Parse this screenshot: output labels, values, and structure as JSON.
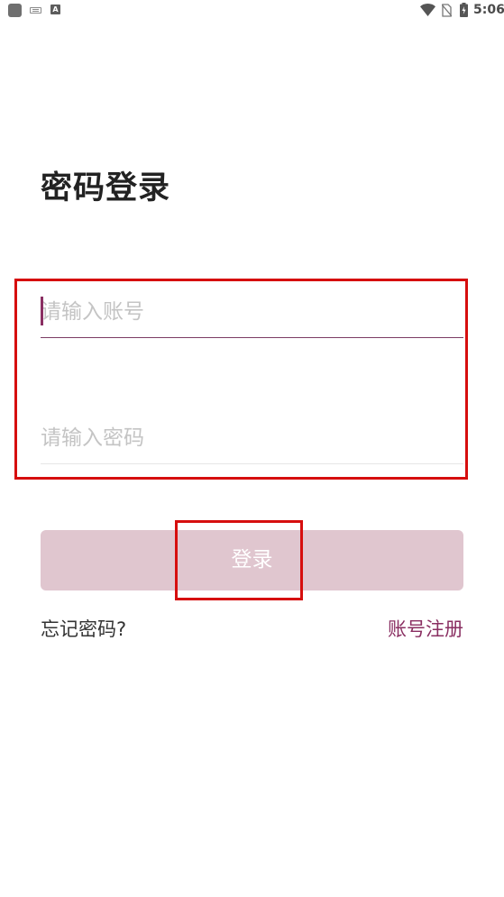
{
  "status_bar": {
    "time": "5:06",
    "icons": [
      "app-icon",
      "keyboard-icon",
      "text-a-icon",
      "wifi-icon",
      "no-sim-icon",
      "battery-charging-icon"
    ]
  },
  "page": {
    "title": "密码登录"
  },
  "form": {
    "account_placeholder": "请输入账号",
    "account_value": "",
    "password_placeholder": "请输入密码",
    "password_value": ""
  },
  "login_button": {
    "label": "登录"
  },
  "links": {
    "forgot_password": "忘记密码?",
    "register": "账号注册"
  },
  "colors": {
    "accent": "#8a2f62",
    "button_disabled": "#e0c6cf",
    "highlight": "#d60e0e"
  }
}
